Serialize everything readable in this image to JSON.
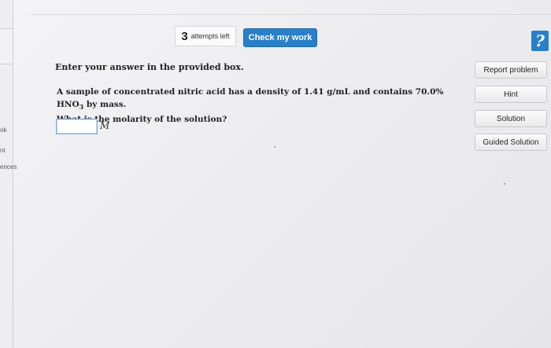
{
  "left_rail": {
    "items": [
      "ok",
      "nt",
      "ences"
    ]
  },
  "toolbar": {
    "attempts_count": "3",
    "attempts_label": "attempts left",
    "check_label": "Check my work",
    "help_label": "?"
  },
  "question": {
    "instruction": "Enter your answer in the provided box.",
    "line1_pre": "A sample of concentrated nitric acid has a density of 1.41 g/mL and contains 70.0% HNO",
    "line1_sub": "3",
    "line1_post": " by mass.",
    "line2": "What is the molarity of the solution?",
    "answer_value": "",
    "unit": "M"
  },
  "side_buttons": {
    "report": "Report problem",
    "hint": "Hint",
    "solution": "Solution",
    "guided": "Guided Solution"
  },
  "colors": {
    "accent": "#2a7fc9",
    "input_border": "#7aa6d8"
  }
}
